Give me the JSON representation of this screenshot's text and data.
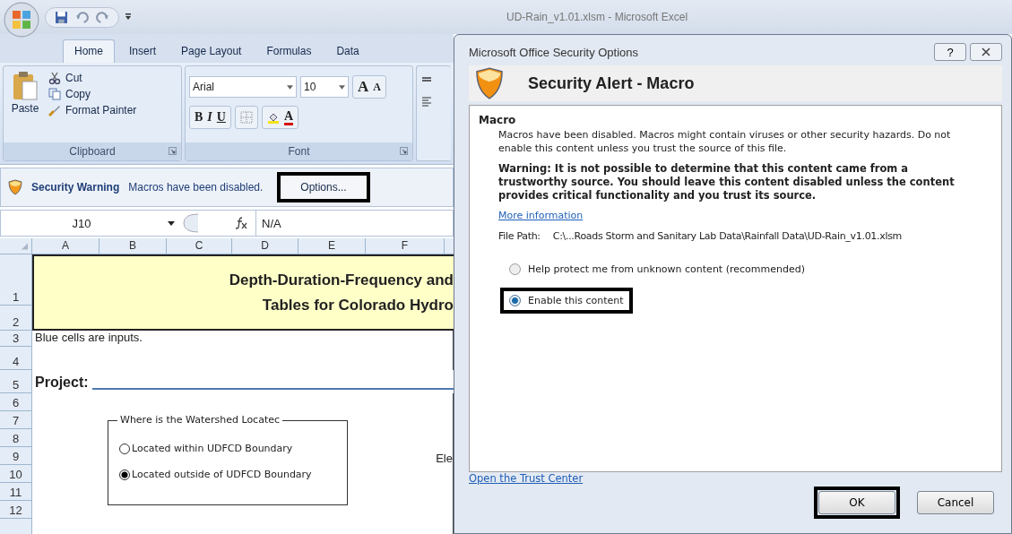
{
  "title_bar": {
    "title": "UD-Rain_v1.01.xlsm - Microsoft Excel"
  },
  "ribbon_tabs": [
    {
      "label": "Home",
      "selected": true
    },
    {
      "label": "Insert",
      "selected": false
    },
    {
      "label": "Page Layout",
      "selected": false
    },
    {
      "label": "Formulas",
      "selected": false
    },
    {
      "label": "Data",
      "selected": false
    }
  ],
  "clipboard_group": {
    "label": "Clipboard",
    "paste": "Paste",
    "commands": [
      "Cut",
      "Copy",
      "Format Painter"
    ]
  },
  "font_group": {
    "label": "Font",
    "font_name": "Arial",
    "font_size": "10",
    "grow_font": "A",
    "shrink_font": "A",
    "style_buttons": [
      "B",
      "I",
      "U"
    ],
    "font_color": "A"
  },
  "security_bar": {
    "title": "Security Warning",
    "message": "Macros have been disabled.",
    "button": {
      "label": "Options...",
      "outlined": true
    }
  },
  "formula_bar": {
    "name_box": "J10",
    "formula": "N/A"
  },
  "column_headers": [
    "A",
    "B",
    "C",
    "D",
    "E",
    "F"
  ],
  "row_numbers": [
    "1",
    "2",
    "3",
    "4",
    "5",
    "6",
    "7",
    "8",
    "9",
    "10",
    "11",
    "12"
  ],
  "sheet": {
    "title_lines": [
      "Depth-Duration-Frequency and",
      "Tables for Colorado Hydro"
    ],
    "note": "Blue cells are inputs.",
    "project_label": "Project:",
    "group_box": {
      "label": "Where is the Watershed Locatec",
      "options": [
        {
          "label": "Located within UDFCD Boundary",
          "selected": false
        },
        {
          "label": "Located outside of UDFCD Boundary",
          "selected": true
        }
      ]
    },
    "cut_label": "Ele"
  },
  "dialog": {
    "title": "Microsoft Office Security Options",
    "help_button": "?",
    "heading": "Security Alert - Macro",
    "section": "Macro",
    "description": "Macros have been disabled. Macros might contain viruses or other security hazards. Do not enable this content unless you trust the source of this file.",
    "warning": "Warning: It is not possible to determine that this content came from a trustworthy source. You should leave this content disabled unless the content provides critical functionality and you trust its source.",
    "more_info_link": "More information",
    "file_path_label": "File Path:",
    "file_path": "C:\\...Roads Storm and Sanitary Lab Data\\Rainfall Data\\UD-Rain_v1.01.xlsm",
    "options": [
      {
        "label": "Help protect me from unknown content (recommended)",
        "selected": false,
        "outlined": false
      },
      {
        "label": "Enable this content",
        "selected": true,
        "outlined": true
      }
    ],
    "trust_center_link": "Open the Trust Center",
    "buttons": [
      {
        "label": "OK",
        "outlined": true
      },
      {
        "label": "Cancel",
        "outlined": false
      }
    ]
  }
}
